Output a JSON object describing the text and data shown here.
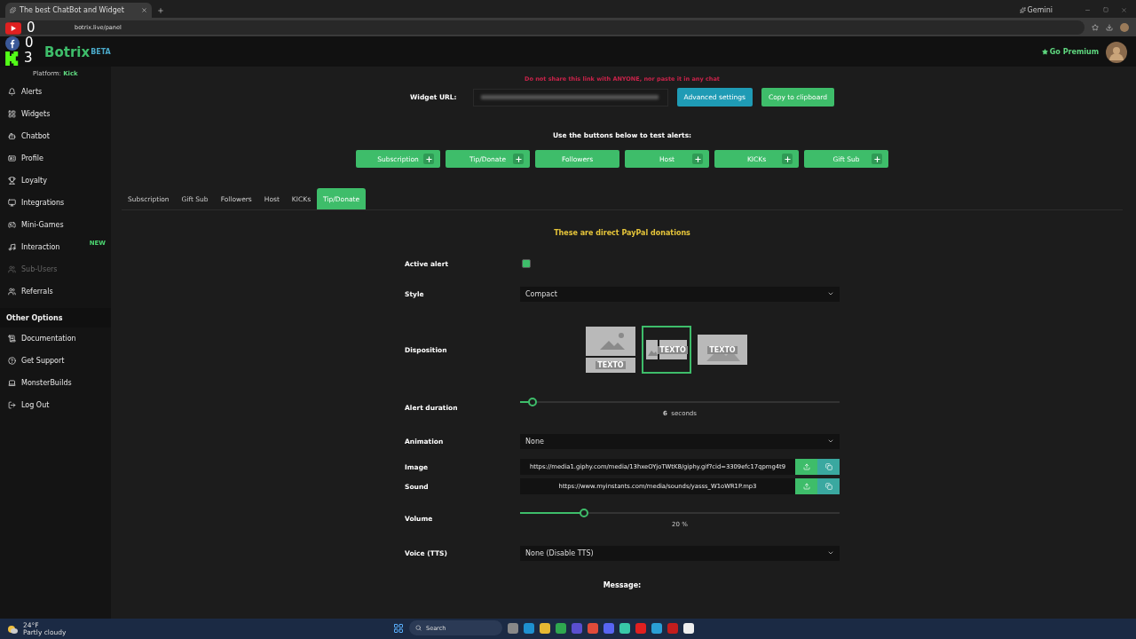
{
  "browser": {
    "tab_title": "The best ChatBot and Widget",
    "address": "botrix.live/panel",
    "gemini": "Gemini"
  },
  "overlay": {
    "counters": [
      {
        "kind": "youtube",
        "value": "0"
      },
      {
        "kind": "facebook",
        "value": "0"
      },
      {
        "kind": "kick",
        "value": "3"
      }
    ]
  },
  "header": {
    "logo": "Botrix",
    "beta": "BETA",
    "premium": "Go Premium"
  },
  "sidebar": {
    "platform_label": "Platform:",
    "platform": "Kick",
    "items": [
      {
        "label": "Alerts",
        "disabled": false
      },
      {
        "label": "Widgets",
        "disabled": false
      },
      {
        "label": "Chatbot",
        "disabled": false
      },
      {
        "label": "Profile",
        "disabled": false
      },
      {
        "label": "Loyalty",
        "disabled": false
      },
      {
        "label": "Integrations",
        "disabled": false
      },
      {
        "label": "Mini-Games",
        "disabled": false
      },
      {
        "label": "Interaction",
        "disabled": false,
        "badge": "NEW"
      },
      {
        "label": "Sub-Users",
        "disabled": true
      },
      {
        "label": "Referrals",
        "disabled": false
      }
    ],
    "section": "Other Options",
    "other_items": [
      {
        "label": "Documentation"
      },
      {
        "label": "Get Support"
      },
      {
        "label": "MonsterBuilds"
      },
      {
        "label": "Log Out"
      }
    ]
  },
  "widget": {
    "warning": "Do not share this link with ANYONE, nor paste it in any chat",
    "label": "Widget URL:",
    "advanced": "Advanced settings",
    "copy": "Copy to clipboard"
  },
  "test": {
    "title": "Use the buttons below to test alerts:",
    "buttons": [
      {
        "label": "Subscription",
        "plus": true
      },
      {
        "label": "Tip/Donate",
        "plus": true
      },
      {
        "label": "Followers",
        "plus": false
      },
      {
        "label": "Host",
        "plus": true
      },
      {
        "label": "KICKs",
        "plus": true
      },
      {
        "label": "Gift Sub",
        "plus": true
      }
    ]
  },
  "tabs": [
    {
      "label": "Subscription",
      "selected": false
    },
    {
      "label": "Gift Sub",
      "selected": false
    },
    {
      "label": "Followers",
      "selected": false
    },
    {
      "label": "Host",
      "selected": false
    },
    {
      "label": "KICKs",
      "selected": false
    },
    {
      "label": "Tip/Donate",
      "selected": true
    }
  ],
  "form": {
    "notice": "These are direct PayPal donations",
    "active_label": "Active alert",
    "active": true,
    "style_label": "Style",
    "style": "Compact",
    "disposition_label": "Disposition",
    "dispositions": [
      {
        "kind": "stacked",
        "text": "TEXTO",
        "selected": false
      },
      {
        "kind": "side",
        "text": "TEXTO",
        "selected": true
      },
      {
        "kind": "overlay",
        "text": "TEXTO",
        "selected": false
      }
    ],
    "duration_label": "Alert duration",
    "duration": {
      "level": 0.04,
      "value": "6",
      "unit": "seconds"
    },
    "animation_label": "Animation",
    "animation": "None",
    "image_label": "Image",
    "image": "https://media1.giphy.com/media/13hxeOYjoTWtK8/giphy.gif?cid=3309efc17qpmg4t9",
    "sound_label": "Sound",
    "sound": "https://www.myinstants.com/media/sounds/yasss_W1oWR1P.mp3",
    "volume_label": "Volume",
    "volume": {
      "level": 0.2,
      "value": "20",
      "unit": "%"
    },
    "voice_label": "Voice (TTS)",
    "voice": "None (Disable TTS)",
    "message_label": "Message:"
  },
  "taskbar": {
    "temp": "24°F",
    "weather": "Partly cloudy",
    "search": "Search"
  }
}
